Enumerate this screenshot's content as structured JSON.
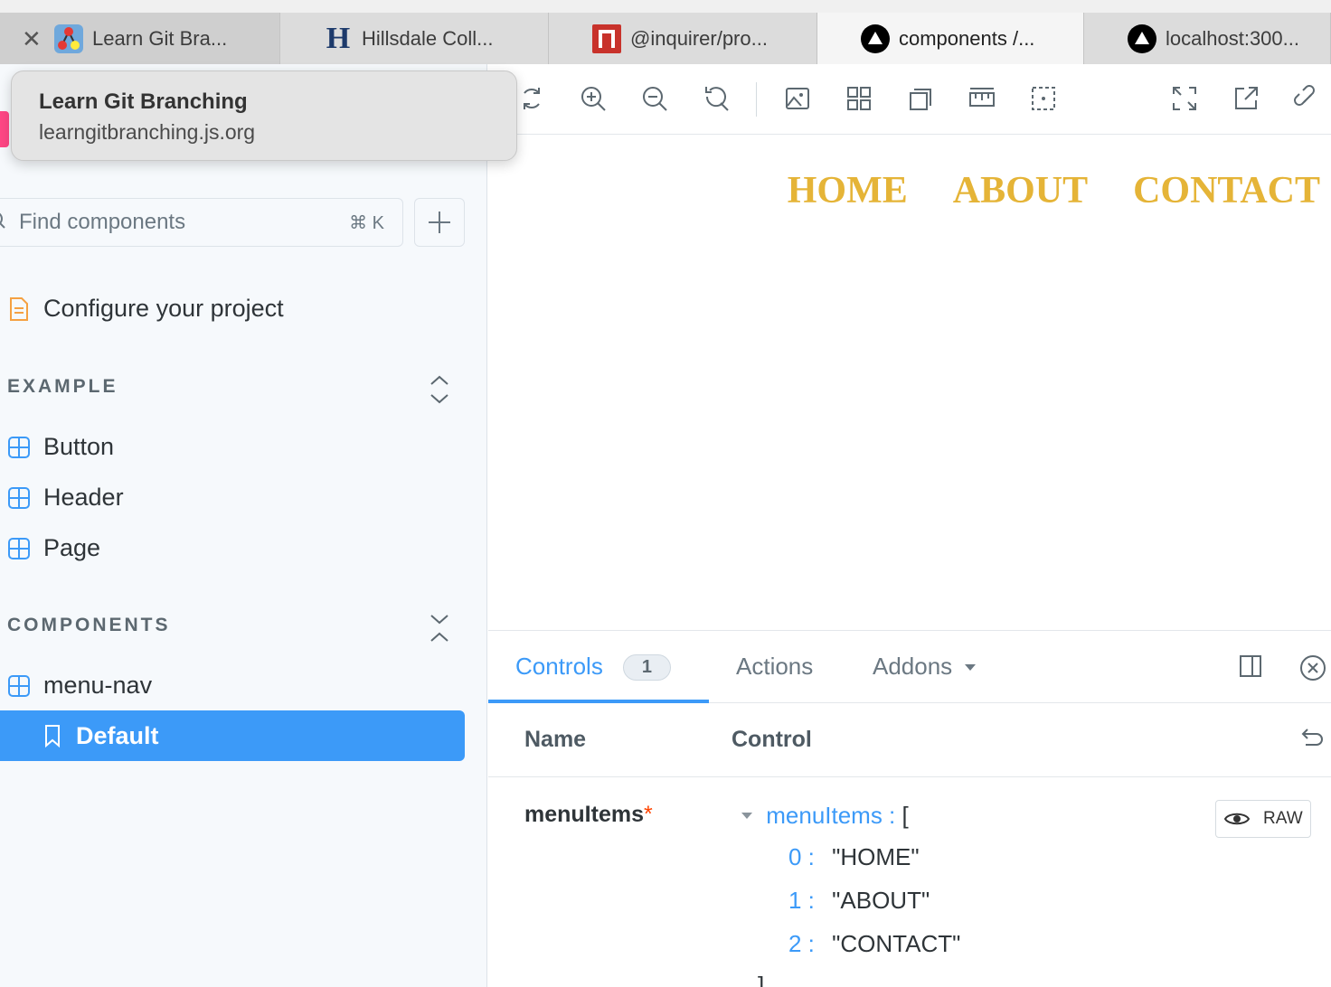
{
  "browser": {
    "tabs": [
      {
        "label": "Learn Git Bra...",
        "icon": "git-branching-favicon",
        "active": false
      },
      {
        "label": "Hillsdale Coll...",
        "icon": "hillsdale-h-favicon",
        "active": false
      },
      {
        "label": "@inquirer/pro...",
        "icon": "npm-favicon",
        "active": false
      },
      {
        "label": "components /...",
        "icon": "triangle-favicon",
        "active": true
      },
      {
        "label": "localhost:300...",
        "icon": "triangle-favicon",
        "active": false
      }
    ],
    "close_glyph": "✕",
    "tooltip": {
      "title": "Learn Git Branching",
      "url": "learngitbranching.js.org"
    }
  },
  "sidebar": {
    "search": {
      "placeholder": "Find components",
      "shortcut": "⌘ K"
    },
    "configure_label": "Configure your project",
    "sections": [
      {
        "title": "EXAMPLE",
        "items": [
          "Button",
          "Header",
          "Page"
        ]
      },
      {
        "title": "COMPONENTS",
        "items": [
          "menu-nav"
        ]
      }
    ],
    "selected_story": "Default"
  },
  "toolbar": {
    "icons": [
      "reload-icon",
      "zoom-in-icon",
      "zoom-out-icon",
      "zoom-reset-icon",
      "background-icon",
      "grid-icon",
      "viewport-icon",
      "measure-icon",
      "outline-icon",
      "fullscreen-icon",
      "open-new-tab-icon",
      "copy-link-icon"
    ]
  },
  "preview": {
    "menu_items": [
      "HOME",
      "ABOUT",
      "CONTACT"
    ],
    "menu_color": "#e5b437"
  },
  "addons": {
    "tabs": {
      "controls": "Controls",
      "controls_count": "1",
      "actions": "Actions",
      "addons": "Addons"
    },
    "table": {
      "name_header": "Name",
      "control_header": "Control"
    },
    "row": {
      "name": "menuItems",
      "required_mark": "*",
      "json_key": "menuItems :",
      "open_bracket": "[",
      "close_bracket": "]",
      "items": [
        {
          "index": "0 :",
          "value": "\"HOME\""
        },
        {
          "index": "1 :",
          "value": "\"ABOUT\""
        },
        {
          "index": "2 :",
          "value": "\"CONTACT\""
        }
      ],
      "raw_label": "RAW"
    }
  },
  "colors": {
    "accent": "#3c9af8",
    "sidebar_bg": "#f6f9fc",
    "required": "#ff4400"
  }
}
